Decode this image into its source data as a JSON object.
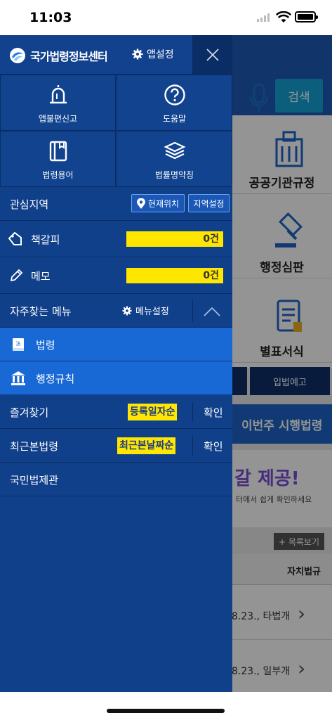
{
  "status_bar": {
    "time": "11:03"
  },
  "background": {
    "search_button": "검색",
    "grid": [
      "공공기관규정",
      "행정심판",
      "별표서식"
    ],
    "tab": "입법예고",
    "banner": "이번주 시행법령",
    "ad_title": "갈 제공!",
    "ad_sub": "터에서 쉽게 확인하세요",
    "more_button": "+ 목록보기",
    "table_header": "자치법규",
    "rows": [
      "8.23., 타법개",
      "8.23., 일부개"
    ]
  },
  "drawer": {
    "brand": "국가법령정보센터",
    "app_settings": "앱설정",
    "tiles": [
      {
        "label": "앱불편신고",
        "icon": "alarm-icon"
      },
      {
        "label": "도움말",
        "icon": "help-icon"
      },
      {
        "label": "법령용어",
        "icon": "book-icon"
      },
      {
        "label": "법률명약칭",
        "icon": "layers-icon"
      }
    ],
    "region": {
      "label": "관심지역",
      "current_location": "현재위치",
      "region_settings": "지역설정"
    },
    "bookmark": {
      "label": "책갈피",
      "count": "0건"
    },
    "memo": {
      "label": "메모",
      "count": "0건"
    },
    "frequent": {
      "label": "자주찾는 메뉴",
      "settings": "메뉴설정"
    },
    "menu_items": [
      {
        "label": "법령",
        "icon": "law-book-icon"
      },
      {
        "label": "행정규칙",
        "icon": "building-icon"
      }
    ],
    "favorites": {
      "label": "즐겨찾기",
      "sort": "등록일자순",
      "confirm": "확인"
    },
    "recent": {
      "label": "최근본법령",
      "sort": "최근본날짜순",
      "confirm": "확인"
    },
    "hall": {
      "label": "국민법제관"
    }
  },
  "colors": {
    "drawer_bg": "#11408a",
    "highlight": "#1869d6",
    "yellow": "#ffe600"
  }
}
